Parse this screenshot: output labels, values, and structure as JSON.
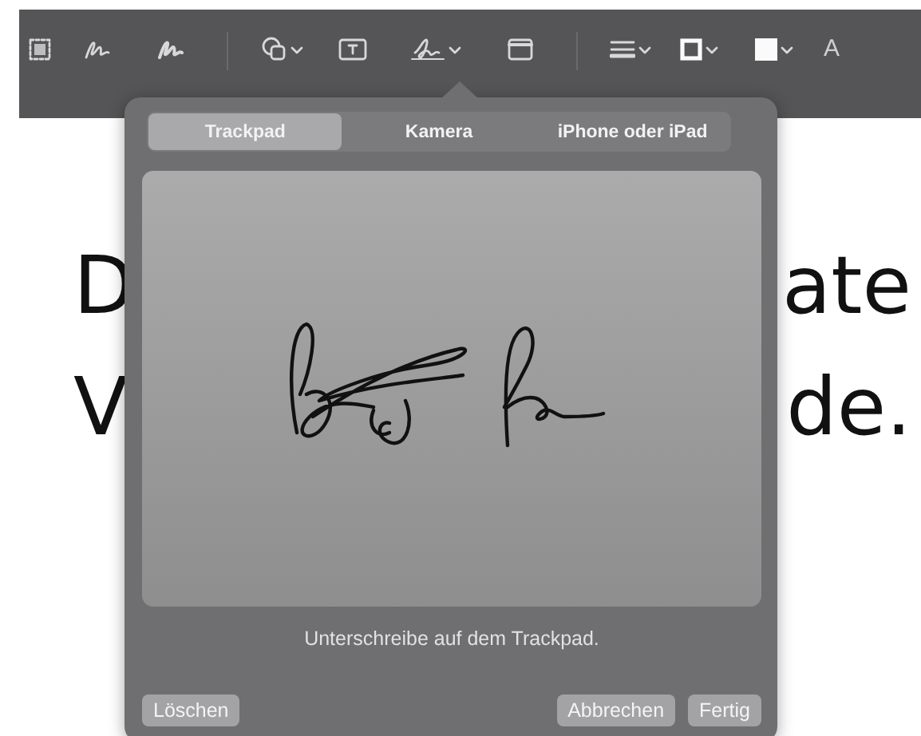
{
  "toolbar": {
    "tools": [
      {
        "kind": "select",
        "menu": false
      },
      {
        "kind": "sketch",
        "menu": false
      },
      {
        "kind": "draw",
        "menu": false
      },
      {
        "kind": "divider"
      },
      {
        "kind": "shapes",
        "menu": true
      },
      {
        "kind": "textbox",
        "menu": false
      },
      {
        "kind": "sign",
        "menu": true
      },
      {
        "kind": "window",
        "menu": false
      },
      {
        "kind": "divider"
      },
      {
        "kind": "lines",
        "menu": true
      },
      {
        "kind": "border",
        "menu": true
      },
      {
        "kind": "fill",
        "menu": true
      }
    ],
    "font_label": "A"
  },
  "document": {
    "lines": [
      {
        "left": "D",
        "right": "ate"
      },
      {
        "left": "V",
        "right": "de."
      }
    ]
  },
  "signature_popover": {
    "tabs": [
      {
        "label": "Trackpad",
        "selected": true
      },
      {
        "label": "Kamera",
        "selected": false
      },
      {
        "label": "iPhone oder iPad",
        "selected": false
      }
    ],
    "hint": "Unterschreibe auf dem Trackpad.",
    "buttons": [
      {
        "label": "Löschen",
        "kind": "left"
      },
      {
        "label": "Abbrechen",
        "kind": "right"
      },
      {
        "label": "Fertig",
        "kind": "right"
      }
    ]
  }
}
